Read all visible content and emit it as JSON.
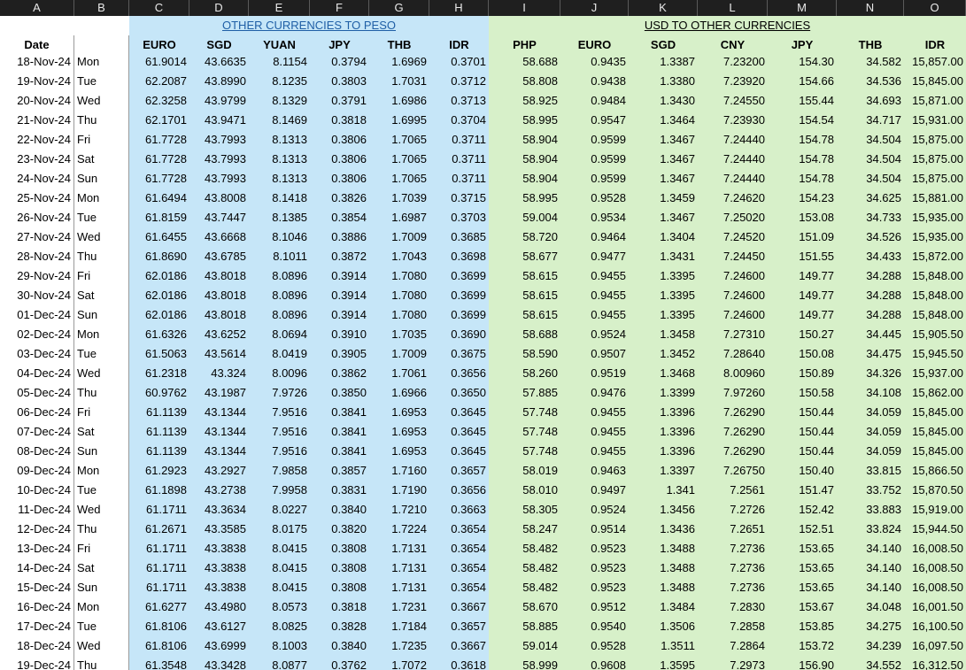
{
  "column_letters": [
    "A",
    "B",
    "C",
    "D",
    "E",
    "F",
    "G",
    "H",
    "I",
    "J",
    "K",
    "L",
    "M",
    "N",
    "O"
  ],
  "sections": {
    "peso": "OTHER CURRENCIES TO PESO",
    "usd": "USD TO OTHER CURRENCIES"
  },
  "headers": [
    "Date",
    "",
    "EURO",
    "SGD",
    "YUAN",
    "JPY",
    "THB",
    "IDR",
    "PHP",
    "EURO",
    "SGD",
    "CNY",
    "JPY",
    "THB",
    "IDR"
  ],
  "rows": [
    [
      "18-Nov-24",
      "Mon",
      "61.9014",
      "43.6635",
      "8.1154",
      "0.3794",
      "1.6969",
      "0.3701",
      "58.688",
      "0.9435",
      "1.3387",
      "7.23200",
      "154.30",
      "34.582",
      "15,857.00"
    ],
    [
      "19-Nov-24",
      "Tue",
      "62.2087",
      "43.8990",
      "8.1235",
      "0.3803",
      "1.7031",
      "0.3712",
      "58.808",
      "0.9438",
      "1.3380",
      "7.23920",
      "154.66",
      "34.536",
      "15,845.00"
    ],
    [
      "20-Nov-24",
      "Wed",
      "62.3258",
      "43.9799",
      "8.1329",
      "0.3791",
      "1.6986",
      "0.3713",
      "58.925",
      "0.9484",
      "1.3430",
      "7.24550",
      "155.44",
      "34.693",
      "15,871.00"
    ],
    [
      "21-Nov-24",
      "Thu",
      "62.1701",
      "43.9471",
      "8.1469",
      "0.3818",
      "1.6995",
      "0.3704",
      "58.995",
      "0.9547",
      "1.3464",
      "7.23930",
      "154.54",
      "34.717",
      "15,931.00"
    ],
    [
      "22-Nov-24",
      "Fri",
      "61.7728",
      "43.7993",
      "8.1313",
      "0.3806",
      "1.7065",
      "0.3711",
      "58.904",
      "0.9599",
      "1.3467",
      "7.24440",
      "154.78",
      "34.504",
      "15,875.00"
    ],
    [
      "23-Nov-24",
      "Sat",
      "61.7728",
      "43.7993",
      "8.1313",
      "0.3806",
      "1.7065",
      "0.3711",
      "58.904",
      "0.9599",
      "1.3467",
      "7.24440",
      "154.78",
      "34.504",
      "15,875.00"
    ],
    [
      "24-Nov-24",
      "Sun",
      "61.7728",
      "43.7993",
      "8.1313",
      "0.3806",
      "1.7065",
      "0.3711",
      "58.904",
      "0.9599",
      "1.3467",
      "7.24440",
      "154.78",
      "34.504",
      "15,875.00"
    ],
    [
      "25-Nov-24",
      "Mon",
      "61.6494",
      "43.8008",
      "8.1418",
      "0.3826",
      "1.7039",
      "0.3715",
      "58.995",
      "0.9528",
      "1.3459",
      "7.24620",
      "154.23",
      "34.625",
      "15,881.00"
    ],
    [
      "26-Nov-24",
      "Tue",
      "61.8159",
      "43.7447",
      "8.1385",
      "0.3854",
      "1.6987",
      "0.3703",
      "59.004",
      "0.9534",
      "1.3467",
      "7.25020",
      "153.08",
      "34.733",
      "15,935.00"
    ],
    [
      "27-Nov-24",
      "Wed",
      "61.6455",
      "43.6668",
      "8.1046",
      "0.3886",
      "1.7009",
      "0.3685",
      "58.720",
      "0.9464",
      "1.3404",
      "7.24520",
      "151.09",
      "34.526",
      "15,935.00"
    ],
    [
      "28-Nov-24",
      "Thu",
      "61.8690",
      "43.6785",
      "8.1011",
      "0.3872",
      "1.7043",
      "0.3698",
      "58.677",
      "0.9477",
      "1.3431",
      "7.24450",
      "151.55",
      "34.433",
      "15,872.00"
    ],
    [
      "29-Nov-24",
      "Fri",
      "62.0186",
      "43.8018",
      "8.0896",
      "0.3914",
      "1.7080",
      "0.3699",
      "58.615",
      "0.9455",
      "1.3395",
      "7.24600",
      "149.77",
      "34.288",
      "15,848.00"
    ],
    [
      "30-Nov-24",
      "Sat",
      "62.0186",
      "43.8018",
      "8.0896",
      "0.3914",
      "1.7080",
      "0.3699",
      "58.615",
      "0.9455",
      "1.3395",
      "7.24600",
      "149.77",
      "34.288",
      "15,848.00"
    ],
    [
      "01-Dec-24",
      "Sun",
      "62.0186",
      "43.8018",
      "8.0896",
      "0.3914",
      "1.7080",
      "0.3699",
      "58.615",
      "0.9455",
      "1.3395",
      "7.24600",
      "149.77",
      "34.288",
      "15,848.00"
    ],
    [
      "02-Dec-24",
      "Mon",
      "61.6326",
      "43.6252",
      "8.0694",
      "0.3910",
      "1.7035",
      "0.3690",
      "58.688",
      "0.9524",
      "1.3458",
      "7.27310",
      "150.27",
      "34.445",
      "15,905.50"
    ],
    [
      "03-Dec-24",
      "Tue",
      "61.5063",
      "43.5614",
      "8.0419",
      "0.3905",
      "1.7009",
      "0.3675",
      "58.590",
      "0.9507",
      "1.3452",
      "7.28640",
      "150.08",
      "34.475",
      "15,945.50"
    ],
    [
      "04-Dec-24",
      "Wed",
      "61.2318",
      "43.324",
      "8.0096",
      "0.3862",
      "1.7061",
      "0.3656",
      "58.260",
      "0.9519",
      "1.3468",
      "8.00960",
      "150.89",
      "34.326",
      "15,937.00"
    ],
    [
      "05-Dec-24",
      "Thu",
      "60.9762",
      "43.1987",
      "7.9726",
      "0.3850",
      "1.6966",
      "0.3650",
      "57.885",
      "0.9476",
      "1.3399",
      "7.97260",
      "150.58",
      "34.108",
      "15,862.00"
    ],
    [
      "06-Dec-24",
      "Fri",
      "61.1139",
      "43.1344",
      "7.9516",
      "0.3841",
      "1.6953",
      "0.3645",
      "57.748",
      "0.9455",
      "1.3396",
      "7.26290",
      "150.44",
      "34.059",
      "15,845.00"
    ],
    [
      "07-Dec-24",
      "Sat",
      "61.1139",
      "43.1344",
      "7.9516",
      "0.3841",
      "1.6953",
      "0.3645",
      "57.748",
      "0.9455",
      "1.3396",
      "7.26290",
      "150.44",
      "34.059",
      "15,845.00"
    ],
    [
      "08-Dec-24",
      "Sun",
      "61.1139",
      "43.1344",
      "7.9516",
      "0.3841",
      "1.6953",
      "0.3645",
      "57.748",
      "0.9455",
      "1.3396",
      "7.26290",
      "150.44",
      "34.059",
      "15,845.00"
    ],
    [
      "09-Dec-24",
      "Mon",
      "61.2923",
      "43.2927",
      "7.9858",
      "0.3857",
      "1.7160",
      "0.3657",
      "58.019",
      "0.9463",
      "1.3397",
      "7.26750",
      "150.40",
      "33.815",
      "15,866.50"
    ],
    [
      "10-Dec-24",
      "Tue",
      "61.1898",
      "43.2738",
      "7.9958",
      "0.3831",
      "1.7190",
      "0.3656",
      "58.010",
      "0.9497",
      "1.341",
      "7.2561",
      "151.47",
      "33.752",
      "15,870.50"
    ],
    [
      "11-Dec-24",
      "Wed",
      "61.1711",
      "43.3634",
      "8.0227",
      "0.3840",
      "1.7210",
      "0.3663",
      "58.305",
      "0.9524",
      "1.3456",
      "7.2726",
      "152.42",
      "33.883",
      "15,919.00"
    ],
    [
      "12-Dec-24",
      "Thu",
      "61.2671",
      "43.3585",
      "8.0175",
      "0.3820",
      "1.7224",
      "0.3654",
      "58.247",
      "0.9514",
      "1.3436",
      "7.2651",
      "152.51",
      "33.824",
      "15,944.50"
    ],
    [
      "13-Dec-24",
      "Fri",
      "61.1711",
      "43.3838",
      "8.0415",
      "0.3808",
      "1.7131",
      "0.3654",
      "58.482",
      "0.9523",
      "1.3488",
      "7.2736",
      "153.65",
      "34.140",
      "16,008.50"
    ],
    [
      "14-Dec-24",
      "Sat",
      "61.1711",
      "43.3838",
      "8.0415",
      "0.3808",
      "1.7131",
      "0.3654",
      "58.482",
      "0.9523",
      "1.3488",
      "7.2736",
      "153.65",
      "34.140",
      "16,008.50"
    ],
    [
      "15-Dec-24",
      "Sun",
      "61.1711",
      "43.3838",
      "8.0415",
      "0.3808",
      "1.7131",
      "0.3654",
      "58.482",
      "0.9523",
      "1.3488",
      "7.2736",
      "153.65",
      "34.140",
      "16,008.50"
    ],
    [
      "16-Dec-24",
      "Mon",
      "61.6277",
      "43.4980",
      "8.0573",
      "0.3818",
      "1.7231",
      "0.3667",
      "58.670",
      "0.9512",
      "1.3484",
      "7.2830",
      "153.67",
      "34.048",
      "16,001.50"
    ],
    [
      "17-Dec-24",
      "Tue",
      "61.8106",
      "43.6127",
      "8.0825",
      "0.3828",
      "1.7184",
      "0.3657",
      "58.885",
      "0.9540",
      "1.3506",
      "7.2858",
      "153.85",
      "34.275",
      "16,100.50"
    ],
    [
      "18-Dec-24",
      "Wed",
      "61.8106",
      "43.6999",
      "8.1003",
      "0.3840",
      "1.7235",
      "0.3667",
      "59.014",
      "0.9528",
      "1.3511",
      "7.2864",
      "153.72",
      "34.239",
      "16,097.50"
    ],
    [
      "19-Dec-24",
      "Thu",
      "61.3548",
      "43.3428",
      "8.0877",
      "0.3762",
      "1.7072",
      "0.3618",
      "58.999",
      "0.9608",
      "1.3595",
      "7.2973",
      "156.90",
      "34.552",
      "16,312.50"
    ]
  ]
}
